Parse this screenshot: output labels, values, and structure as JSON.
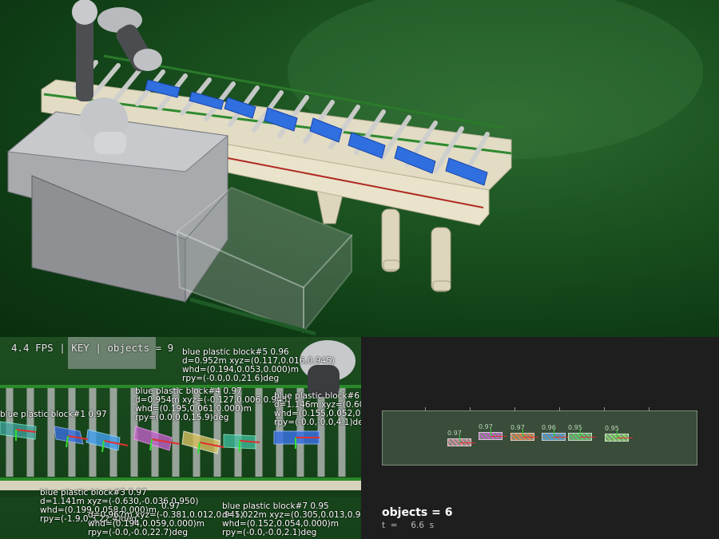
{
  "hud": {
    "status": "4.4  FPS  |  KEY  |  objects = 9"
  },
  "detections": [
    {
      "name": "blue plastic block#5",
      "score": "0.96",
      "d": "d=0.952m xyz=(0.117,0.016,0.945)",
      "whd": "whd=(0.194,0.053,0.000)m",
      "rpy": "rpy=(-0.0,0.0,21.6)deg"
    },
    {
      "name": "blue plastic block#4",
      "score": "0.97",
      "d": "d=0.954m xyz=(-0.127,0.006,0.945)",
      "whd": "whd=(0.195,0.061,0.000)m",
      "rpy": "rpy=(0.0,0.0,15.9)deg"
    },
    {
      "name": "blue plastic block#6",
      "score": "0.",
      "d": "d=1.146m xyz=(0.602,",
      "whd": "whd=(0.155,0.052,0.",
      "rpy": "rpy=(-0.0,-0.0,4.1)deg"
    },
    {
      "name": "blue plastic block#1",
      "score": "0.97",
      "d": "",
      "whd": "",
      "rpy": ""
    },
    {
      "name": "blue plastic block#3",
      "score": "0.97",
      "d": "d=1.141m xyz=(-0.630,-0.036,0.950)",
      "whd": "whd=(0.199,0.058,0.000)m",
      "rpy": "rpy=(-1.9,0.3,22.4)deg"
    },
    {
      "name": "",
      "score": "0.97",
      "d": "d=0.967m xyz=(-0.381,0.012,0.945)",
      "whd": "whd=(0.194,0.059,0.000)m",
      "rpy": "rpy=(-0.0,-0.0,22.7)deg"
    },
    {
      "name": "blue plastic block#7",
      "score": "0.95",
      "d": "d=1.022m xyz=(0.305,0.013,0.975)",
      "whd": "whd=(0.152,0.054,0.000)m",
      "rpy": "rpy=(-0.0,-0.0,2.1)deg"
    }
  ],
  "map": {
    "objects_label": "objects  =  6",
    "time_label": "t  =     6.6  s",
    "mini_blocks": [
      {
        "score": "0.97",
        "color": "#d88aa0"
      },
      {
        "score": "0.97",
        "color": "#c060c8"
      },
      {
        "score": "0.97",
        "color": "#e08040"
      },
      {
        "score": "0.96",
        "color": "#4a9ad8"
      },
      {
        "score": "0.95",
        "color": "#58c860"
      },
      {
        "score": "0.95",
        "color": "#80e060"
      }
    ]
  }
}
